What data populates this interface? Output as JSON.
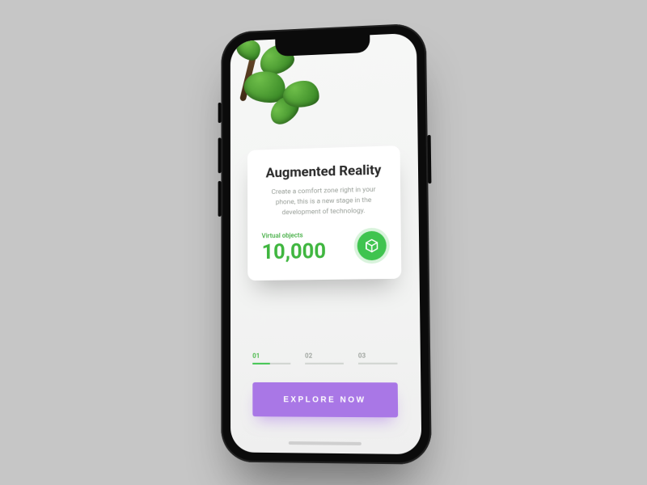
{
  "colors": {
    "accent_green": "#3fc44f",
    "accent_purple": "#a977e6"
  },
  "card": {
    "title": "Augmented Reality",
    "description": "Create a comfort zone right in your phone, this is a new stage in the development of technology.",
    "stat_label": "Virtual objects",
    "stat_value": "10,000",
    "icon": "cube-icon"
  },
  "pager": {
    "items": [
      "01",
      "02",
      "03"
    ],
    "active_index": 0
  },
  "cta": {
    "label": "EXPLORE NOW"
  }
}
